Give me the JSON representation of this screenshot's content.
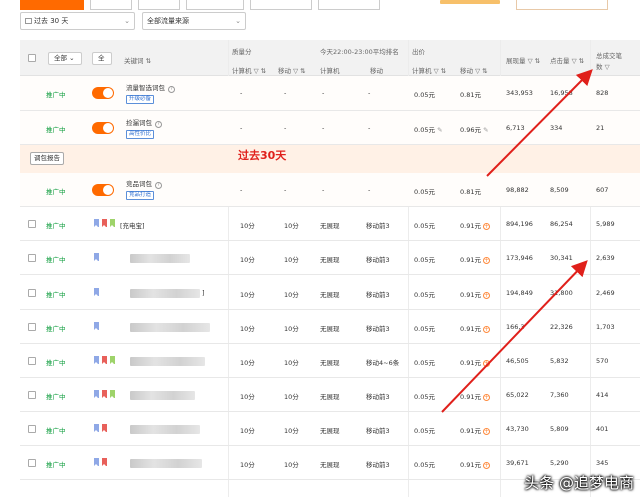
{
  "filters": {
    "date_range": "过去 30 天",
    "traffic_source": "全部流量来源"
  },
  "header": {
    "filter_all": "全部",
    "filter_all2": "全",
    "keyword": "关键词 ⇅",
    "quality_score": "质量分",
    "quality_pc": "计算机 ▽ ⇅",
    "quality_mobile": "移动 ▽ ⇅",
    "rank_title": "今天22:00-23:00平均排名",
    "rank_pc": "计算机",
    "rank_mobile": "移动",
    "bid_title": "出价",
    "bid_pc": "计算机 ▽ ⇅",
    "bid_mobile": "移动 ▽ ⇅",
    "impressions": "展现量 ▽ ⇅",
    "clicks": "点击量 ▽ ⇅",
    "conversions_line1": "总成交笔",
    "conversions_line2": "数 ▽"
  },
  "report_button": "调包报告",
  "annotation": "过去30天",
  "watermark": "头条 @追梦电商",
  "rows": [
    {
      "status": "推广中",
      "keyword": "流量智选词包",
      "tag": "升级必备",
      "q_pc": "-",
      "q_mobile": "-",
      "r_pc": "-",
      "r_mobile": "-",
      "bid_pc": "0.05元",
      "bid_mobile": "0.81元",
      "impressions": "343,953",
      "clicks": "16,958",
      "conversions": "828"
    },
    {
      "status": "推广中",
      "keyword": "捡漏词包",
      "tag": "高性价比",
      "q_pc": "-",
      "q_mobile": "-",
      "r_pc": "-",
      "r_mobile": "-",
      "bid_pc": "0.05元",
      "bid_mobile": "0.96元",
      "impressions": "6,713",
      "clicks": "334",
      "conversions": "21"
    },
    {
      "status": "推广中",
      "keyword": "竞品词包",
      "tag": "竞品打造",
      "q_pc": "-",
      "q_mobile": "-",
      "r_pc": "-",
      "r_mobile": "-",
      "bid_pc": "0.05元",
      "bid_mobile": "0.81元",
      "impressions": "98,882",
      "clicks": "8,509",
      "conversions": "607"
    },
    {
      "status": "推广中",
      "keyword": "[充电宝]",
      "q_pc": "10分",
      "q_mobile": "10分",
      "r_pc": "无展现",
      "r_mobile": "移动前3",
      "bid_pc": "0.05元",
      "bid_mobile": "0.91元",
      "impressions": "894,196",
      "clicks": "86,254",
      "conversions": "5,989"
    },
    {
      "status": "推广中",
      "keyword": "",
      "q_pc": "10分",
      "q_mobile": "10分",
      "r_pc": "无展现",
      "r_mobile": "移动前3",
      "bid_pc": "0.05元",
      "bid_mobile": "0.91元",
      "impressions": "173,946",
      "clicks": "30,341",
      "conversions": "2,639"
    },
    {
      "status": "推广中",
      "keyword": "]",
      "q_pc": "10分",
      "q_mobile": "10分",
      "r_pc": "无展现",
      "r_mobile": "移动前3",
      "bid_pc": "0.05元",
      "bid_mobile": "0.91元",
      "impressions": "194,849",
      "clicks": "31,800",
      "conversions": "2,469"
    },
    {
      "status": "推广中",
      "keyword": "",
      "q_pc": "10分",
      "q_mobile": "10分",
      "r_pc": "无展现",
      "r_mobile": "移动前3",
      "bid_pc": "0.05元",
      "bid_mobile": "0.91元",
      "impressions": "166,3",
      "clicks": "22,326",
      "conversions": "1,703"
    },
    {
      "status": "推广中",
      "keyword": "",
      "q_pc": "10分",
      "q_mobile": "10分",
      "r_pc": "无展现",
      "r_mobile": "移动4~6条",
      "bid_pc": "0.05元",
      "bid_mobile": "0.91元",
      "impressions": "46,505",
      "clicks": "5,832",
      "conversions": "570"
    },
    {
      "status": "推广中",
      "keyword": "",
      "q_pc": "10分",
      "q_mobile": "10分",
      "r_pc": "无展现",
      "r_mobile": "移动前3",
      "bid_pc": "0.05元",
      "bid_mobile": "0.91元",
      "impressions": "65,022",
      "clicks": "7,360",
      "conversions": "414"
    },
    {
      "status": "推广中",
      "keyword": "",
      "q_pc": "10分",
      "q_mobile": "10分",
      "r_pc": "无展现",
      "r_mobile": "移动前3",
      "bid_pc": "0.05元",
      "bid_mobile": "0.91元",
      "impressions": "43,730",
      "clicks": "5,809",
      "conversions": "401"
    },
    {
      "status": "推广中",
      "keyword": "",
      "q_pc": "10分",
      "q_mobile": "10分",
      "r_pc": "无展现",
      "r_mobile": "移动前3",
      "bid_pc": "0.05元",
      "bid_mobile": "0.91元",
      "impressions": "39,671",
      "clicks": "5,290",
      "conversions": "345"
    }
  ],
  "colors": {
    "accent": "#ff6a00",
    "status_green": "#0a9b3a",
    "arrow_red": "#e0201b",
    "flag_blue": "#8fa8e6",
    "flag_red": "#e8605a",
    "flag_green": "#9ed36a"
  }
}
